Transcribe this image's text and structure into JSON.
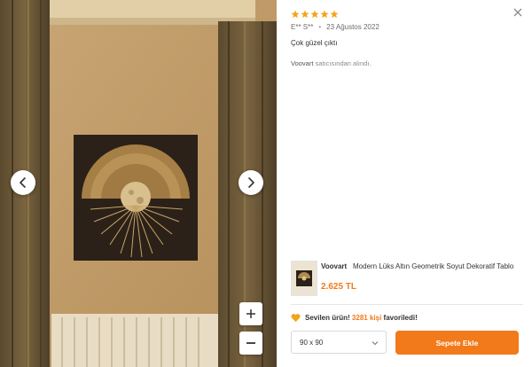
{
  "review": {
    "rating": 5,
    "author": "E** S**",
    "date": "23 Ağustos 2022",
    "comment": "Çok güzel çıktı",
    "seller_name": "Voovart",
    "seller_suffix": "satıcısından alındı."
  },
  "product": {
    "brand": "Voovart",
    "name": "Modern Lüks Altın Geometrik Soyut Dekoratif Tablo",
    "price": "2.625 TL"
  },
  "favorites": {
    "prefix": "Sevilen ürün!",
    "count": "3281 kişi",
    "suffix": "favoriledi!"
  },
  "size_select": {
    "value": "90 x 90"
  },
  "add_to_cart_label": "Sepete Ekle",
  "colors": {
    "accent": "#f27a1a",
    "star": "#f2a51a"
  },
  "icons": [
    "close-icon",
    "star-icon",
    "chevron-left-icon",
    "chevron-right-icon",
    "zoom-in-icon",
    "zoom-out-icon",
    "heart-icon",
    "chevron-down-icon"
  ]
}
